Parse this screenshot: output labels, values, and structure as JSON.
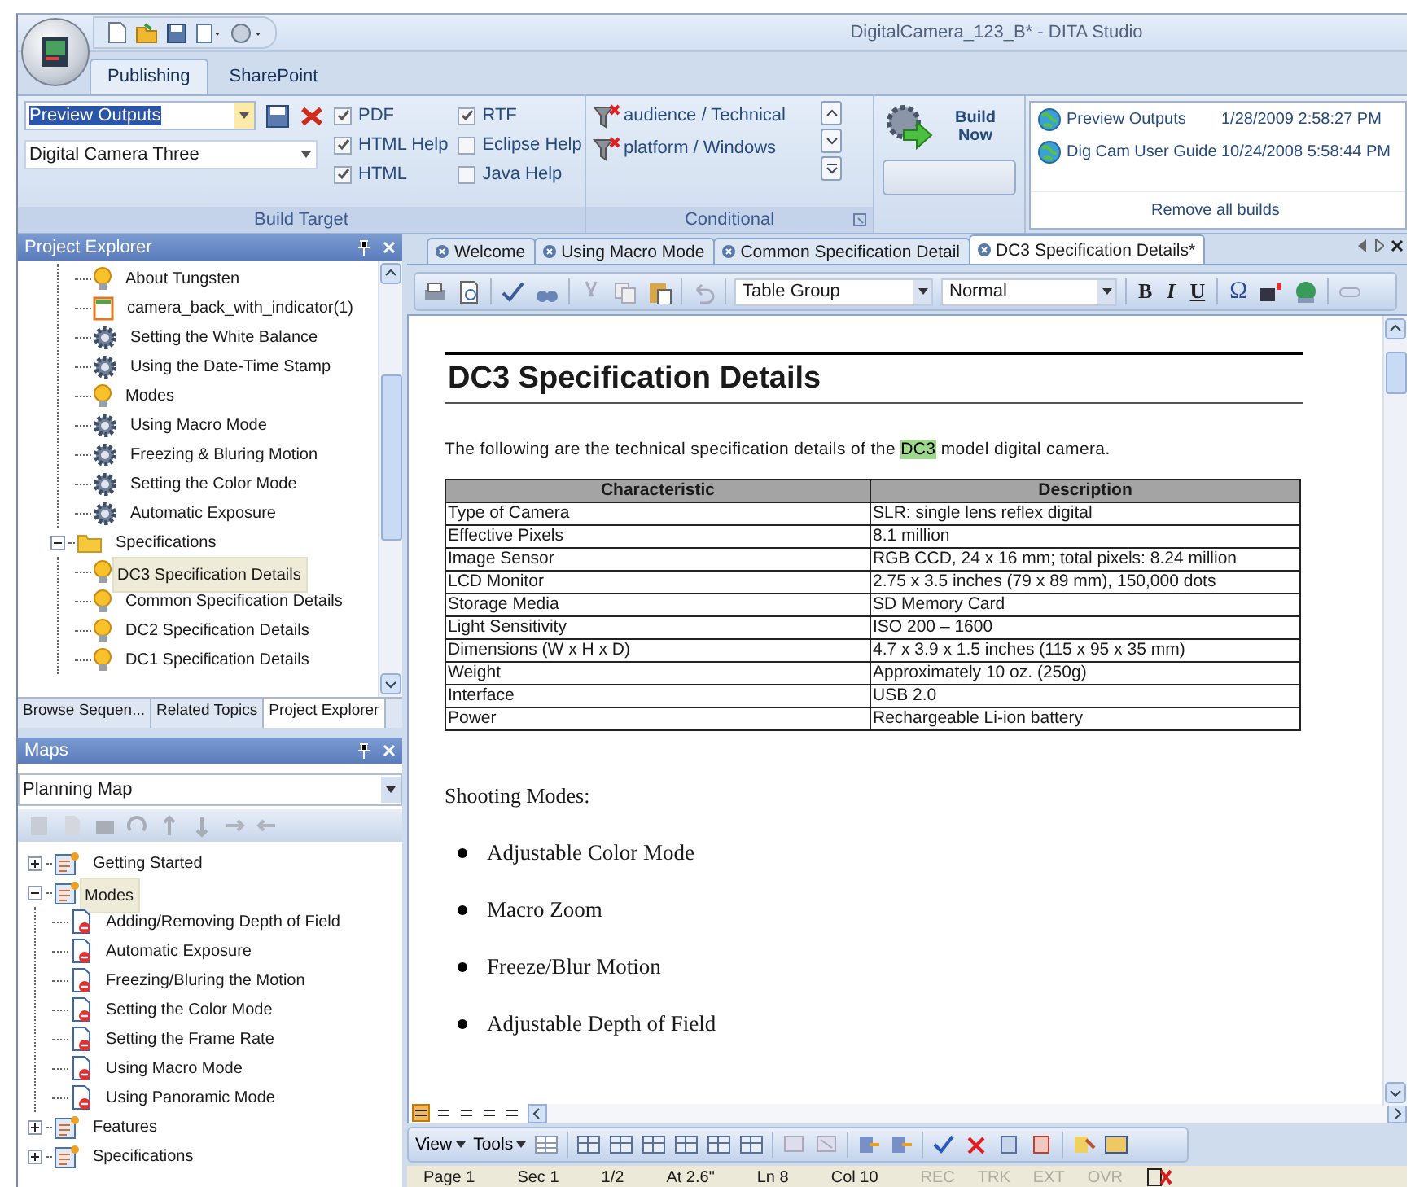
{
  "window": {
    "title": "DigitalCamera_123_B* - DITA Studio"
  },
  "ribbon": {
    "tabs": [
      {
        "label": "Publishing",
        "selected": true
      },
      {
        "label": "SharePoint",
        "selected": false
      }
    ],
    "build_target": {
      "label": "Build Target",
      "output_combo": "Preview Outputs",
      "target_dropdown": "Digital Camera Three",
      "formats": [
        {
          "label": "PDF",
          "checked": true
        },
        {
          "label": "HTML Help",
          "checked": true
        },
        {
          "label": "HTML",
          "checked": true
        },
        {
          "label": "RTF",
          "checked": true
        },
        {
          "label": "Eclipse Help",
          "checked": false
        },
        {
          "label": "Java Help",
          "checked": false
        }
      ]
    },
    "conditional": {
      "label": "Conditional",
      "items": [
        "audience / Technical",
        "platform / Windows"
      ]
    },
    "build_now": "Build Now",
    "builds": [
      {
        "name": "Preview Outputs",
        "time": "1/28/2009 2:58:27 PM"
      },
      {
        "name": "Dig Cam User Guide",
        "time": "10/24/2008 5:58:44 PM"
      }
    ],
    "remove_builds": "Remove all builds"
  },
  "project_explorer": {
    "title": "Project Explorer",
    "tree": [
      {
        "kind": "offscreen",
        "children": [
          {
            "label": "About Tungsten",
            "kind": "bulb",
            "selected": false
          },
          {
            "label": "camera_back_with_indicator(1)",
            "kind": "image",
            "selected": false
          },
          {
            "label": "Setting the White Balance",
            "kind": "gear",
            "selected": false
          },
          {
            "label": "Using the Date-Time Stamp",
            "kind": "gear",
            "selected": false
          },
          {
            "label": "Modes",
            "kind": "bulb",
            "selected": false
          },
          {
            "label": "Using Macro Mode",
            "kind": "gear",
            "selected": false
          },
          {
            "label": "Freezing & Bluring Motion",
            "kind": "gear",
            "selected": false
          },
          {
            "label": "Setting the Color Mode",
            "kind": "gear",
            "selected": false
          },
          {
            "label": "Automatic Exposure",
            "kind": "gear",
            "selected": false
          }
        ]
      },
      {
        "label": "Specifications",
        "kind": "folder",
        "selected": false,
        "expanded": true,
        "children": [
          {
            "label": "DC3 Specification Details",
            "kind": "bulb",
            "selected": true
          },
          {
            "label": "Common Specification Details",
            "kind": "bulb",
            "selected": false
          },
          {
            "label": "DC2 Specification Details",
            "kind": "bulb",
            "selected": false
          },
          {
            "label": "DC1 Specification Details",
            "kind": "bulb",
            "selected": false
          }
        ]
      }
    ],
    "tabs": [
      {
        "label": "Browse Sequen...",
        "selected": false
      },
      {
        "label": "Related Topics",
        "selected": false
      },
      {
        "label": "Project Explorer",
        "selected": true
      }
    ]
  },
  "maps": {
    "title": "Maps",
    "map_dropdown": "Planning Map",
    "tree": [
      {
        "label": "Getting Started",
        "kind": "map",
        "selected": false,
        "expanded": false
      },
      {
        "label": "Modes",
        "kind": "map",
        "selected": true,
        "expanded": true,
        "children": [
          {
            "label": "Adding/Removing Depth of Field",
            "kind": "topic",
            "selected": false
          },
          {
            "label": "Automatic Exposure",
            "kind": "topic",
            "selected": false
          },
          {
            "label": "Freezing/Bluring the Motion",
            "kind": "topic",
            "selected": false
          },
          {
            "label": "Setting the Color Mode",
            "kind": "topic",
            "selected": false
          },
          {
            "label": "Setting the Frame Rate",
            "kind": "topic",
            "selected": false
          },
          {
            "label": "Using Macro Mode",
            "kind": "topic",
            "selected": false
          },
          {
            "label": "Using Panoramic Mode",
            "kind": "topic",
            "selected": false
          }
        ]
      },
      {
        "label": "Features",
        "kind": "map",
        "selected": false,
        "expanded": false
      },
      {
        "label": "Specifications",
        "kind": "map",
        "selected": false,
        "expanded": false
      }
    ]
  },
  "editor": {
    "tabs": [
      {
        "label": "Welcome",
        "selected": false
      },
      {
        "label": "Using Macro Mode",
        "selected": false
      },
      {
        "label": "Common Specification Detail",
        "selected": false
      },
      {
        "label": "DC3 Specification Details*",
        "selected": true
      }
    ],
    "style_dropdown": "Table Group",
    "font_dropdown": "Normal",
    "format_buttons": [
      "B",
      "I",
      "U",
      "Ω"
    ],
    "document": {
      "heading": "DC3 Specification Details",
      "intro": {
        "before": "The following are the technical specification details of the",
        "highlight": "DC3",
        "after": "model digital camera."
      },
      "table": {
        "columns": [
          "Characteristic",
          "Description"
        ],
        "rows": [
          [
            "Type of Camera",
            "SLR: single lens reflex digital"
          ],
          [
            "Effective Pixels",
            "8.1 million"
          ],
          [
            "Image Sensor",
            "RGB CCD, 24 x 16 mm; total pixels: 8.24 million"
          ],
          [
            "LCD Monitor",
            "2.75 x 3.5 inches (79 x 89 mm), 150,000 dots"
          ],
          [
            "Storage Media",
            "SD Memory Card"
          ],
          [
            "Light Sensitivity",
            "ISO 200 – 1600"
          ],
          [
            "Dimensions (W x H x D)",
            "4.7 x 3.9 x 1.5 inches (115 x 95 x 35 mm)"
          ],
          [
            "Weight",
            "Approximately 10 oz. (250g)"
          ],
          [
            "Interface",
            "USB 2.0"
          ],
          [
            "Power",
            "Rechargeable Li-ion battery"
          ]
        ]
      },
      "list_heading": "Shooting Modes:",
      "bullets": [
        "Adjustable Color Mode",
        "Macro Zoom",
        "Freeze/Blur Motion",
        "Adjustable Depth of Field"
      ]
    },
    "bottom_menus": [
      "View",
      "Tools"
    ],
    "status_bar": [
      {
        "text": "Page 1",
        "disabled": false
      },
      {
        "text": "Sec 1",
        "disabled": false
      },
      {
        "text": "1/2",
        "disabled": false
      },
      {
        "text": "At 2.6\"",
        "disabled": false
      },
      {
        "text": "Ln 8",
        "disabled": false
      },
      {
        "text": "Col 10",
        "disabled": false
      },
      {
        "text": "REC",
        "disabled": true
      },
      {
        "text": "TRK",
        "disabled": true
      },
      {
        "text": "EXT",
        "disabled": true
      },
      {
        "text": "OVR",
        "disabled": true
      }
    ]
  }
}
